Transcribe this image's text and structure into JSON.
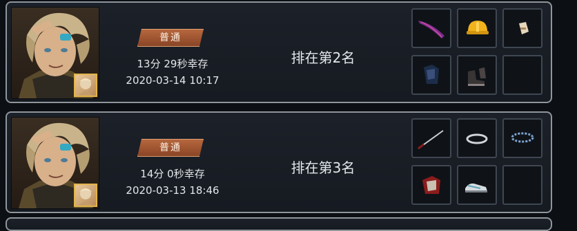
{
  "records": [
    {
      "mode": "普通",
      "survival": "13分 29秒幸存",
      "date": "2020-03-14 10:17",
      "rank": "排在第2名",
      "items": [
        "purple-blade-icon",
        "yellow-helmet-icon",
        "bracer-icon",
        "dark-armor-icon",
        "boots-icon",
        "empty-slot"
      ]
    },
    {
      "mode": "普通",
      "survival": "14分 0秒幸存",
      "date": "2020-03-13 18:46",
      "rank": "排在第3名",
      "items": [
        "katana-icon",
        "silver-ring-icon",
        "blue-bracelet-icon",
        "red-armor-icon",
        "sneakers-icon",
        "empty-slot"
      ]
    }
  ]
}
